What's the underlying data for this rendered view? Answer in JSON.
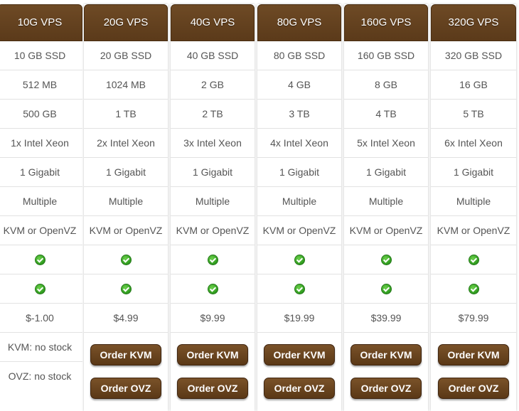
{
  "plans": [
    {
      "name": "10G VPS",
      "specs": [
        "10 GB SSD",
        "512 MB",
        "500 GB",
        "1x Intel Xeon",
        "1 Gigabit",
        "Multiple",
        "KVM or OpenVZ"
      ],
      "checks": [
        "check-icon",
        "check-icon"
      ],
      "price": "$-1.00",
      "kvm_stock": "KVM: no stock",
      "ovz_stock": "OVZ: no stock"
    },
    {
      "name": "20G VPS",
      "specs": [
        "20 GB SSD",
        "1024 MB",
        "1 TB",
        "2x Intel Xeon",
        "1 Gigabit",
        "Multiple",
        "KVM or OpenVZ"
      ],
      "checks": [
        "check-icon",
        "check-icon"
      ],
      "price": "$4.99",
      "order_kvm": "Order KVM",
      "order_ovz": "Order OVZ"
    },
    {
      "name": "40G VPS",
      "specs": [
        "40 GB SSD",
        "2 GB",
        "2 TB",
        "3x Intel Xeon",
        "1 Gigabit",
        "Multiple",
        "KVM or OpenVZ"
      ],
      "checks": [
        "check-icon",
        "check-icon"
      ],
      "price": "$9.99",
      "order_kvm": "Order KVM",
      "order_ovz": "Order OVZ"
    },
    {
      "name": "80G VPS",
      "specs": [
        "80 GB SSD",
        "4 GB",
        "3 TB",
        "4x Intel Xeon",
        "1 Gigabit",
        "Multiple",
        "KVM or OpenVZ"
      ],
      "checks": [
        "check-icon",
        "check-icon"
      ],
      "price": "$19.99",
      "order_kvm": "Order KVM",
      "order_ovz": "Order OVZ"
    },
    {
      "name": "160G VPS",
      "specs": [
        "160 GB SSD",
        "8 GB",
        "4 TB",
        "5x Intel Xeon",
        "1 Gigabit",
        "Multiple",
        "KVM or OpenVZ"
      ],
      "checks": [
        "check-icon",
        "check-icon"
      ],
      "price": "$39.99",
      "order_kvm": "Order KVM",
      "order_ovz": "Order OVZ"
    },
    {
      "name": "320G VPS",
      "specs": [
        "320 GB SSD",
        "16 GB",
        "5 TB",
        "6x Intel Xeon",
        "1 Gigabit",
        "Multiple",
        "KVM or OpenVZ"
      ],
      "checks": [
        "check-icon",
        "check-icon"
      ],
      "price": "$79.99",
      "order_kvm": "Order KVM",
      "order_ovz": "Order OVZ"
    }
  ],
  "colors": {
    "header_brown": "#5b3a1a",
    "button_brown": "#6a4520",
    "check_green": "#2e9a1e",
    "text_gray": "#555555"
  }
}
